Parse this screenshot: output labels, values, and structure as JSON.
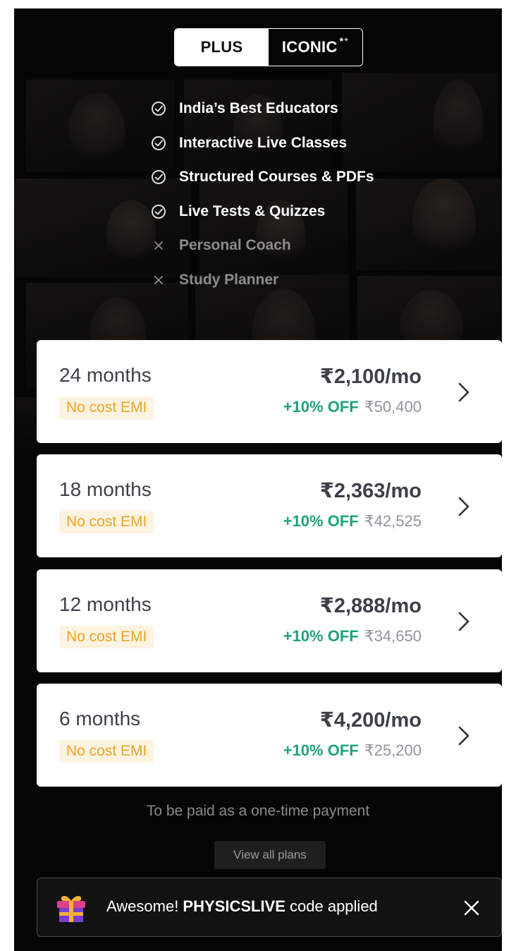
{
  "tabs": {
    "plus": "PLUS",
    "iconic": "ICONIC",
    "iconic_mark": "*⁺"
  },
  "features": [
    {
      "label": "India’s Best Educators",
      "included": true
    },
    {
      "label": "Interactive Live Classes",
      "included": true
    },
    {
      "label": "Structured Courses & PDFs",
      "included": true
    },
    {
      "label": "Live Tests & Quizzes",
      "included": true
    },
    {
      "label": "Personal Coach",
      "included": false
    },
    {
      "label": "Study Planner",
      "included": false
    }
  ],
  "plans": [
    {
      "duration": "24 months",
      "emi": "No cost EMI",
      "price": "₹2,100/mo",
      "discount": "+10% OFF",
      "total": "₹50,400"
    },
    {
      "duration": "18 months",
      "emi": "No cost EMI",
      "price": "₹2,363/mo",
      "discount": "+10% OFF",
      "total": "₹42,525"
    },
    {
      "duration": "12 months",
      "emi": "No cost EMI",
      "price": "₹2,888/mo",
      "discount": "+10% OFF",
      "total": "₹34,650"
    },
    {
      "duration": "6 months",
      "emi": "No cost EMI",
      "price": "₹4,200/mo",
      "discount": "+10% OFF",
      "total": "₹25,200"
    }
  ],
  "payment_note": "To be paid as a one-time payment",
  "view_all_label": "View all plans",
  "toast": {
    "prefix": "Awesome! ",
    "code": "PHYSICSLIVE",
    "suffix": " code applied"
  },
  "colors": {
    "background": "#050505",
    "emi_text": "#f0a51d",
    "emi_bg": "#fdf3e1",
    "discount": "#1ea37a",
    "price_text": "#3c4048"
  },
  "icons": {
    "included": "check-circle-icon",
    "excluded": "cross-icon",
    "chevron": "chevron-right-icon",
    "gift": "gift-icon",
    "close": "close-icon"
  }
}
